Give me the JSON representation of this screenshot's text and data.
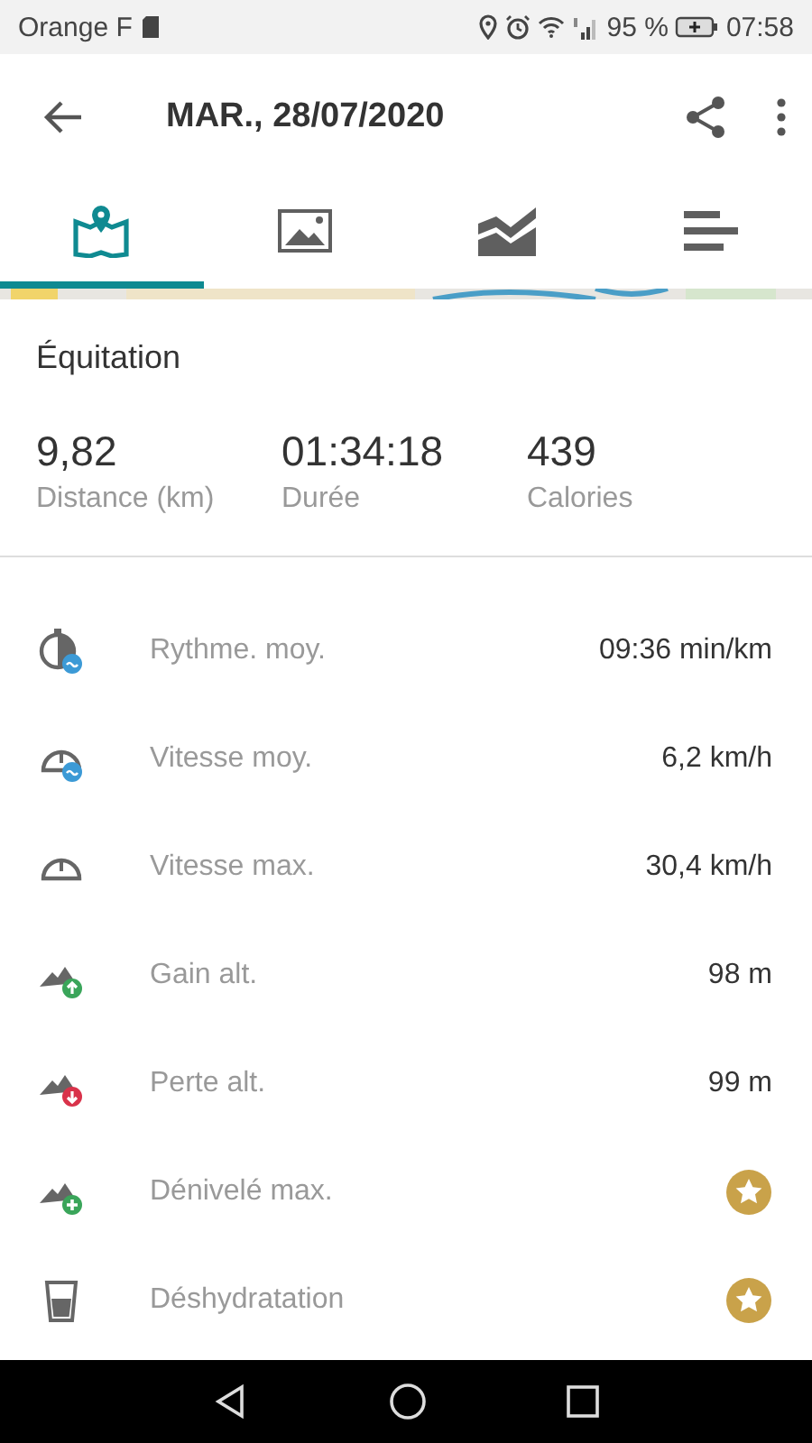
{
  "status_bar": {
    "carrier": "Orange F",
    "battery": "95 %",
    "time": "07:58"
  },
  "app_bar": {
    "title": "MAR., 28/07/2020"
  },
  "tabs": [
    {
      "selected": true
    },
    {
      "selected": false
    },
    {
      "selected": false
    },
    {
      "selected": false
    }
  ],
  "activity": "Équitation",
  "summary": [
    {
      "value": "9,82",
      "label": "Distance (km)"
    },
    {
      "value": "01:34:18",
      "label": "Durée"
    },
    {
      "value": "439",
      "label": "Calories"
    }
  ],
  "metrics": [
    {
      "label": "Rythme. moy.",
      "kind": "text",
      "value": "09:36 min/km"
    },
    {
      "label": "Vitesse moy.",
      "kind": "text",
      "value": "6,2 km/h"
    },
    {
      "label": "Vitesse max.",
      "kind": "text",
      "value": "30,4 km/h"
    },
    {
      "label": "Gain alt.",
      "kind": "text",
      "value": "98 m"
    },
    {
      "label": "Perte alt.",
      "kind": "text",
      "value": "99 m"
    },
    {
      "label": "Dénivelé max.",
      "kind": "star"
    },
    {
      "label": "Déshydratation",
      "kind": "star"
    }
  ]
}
